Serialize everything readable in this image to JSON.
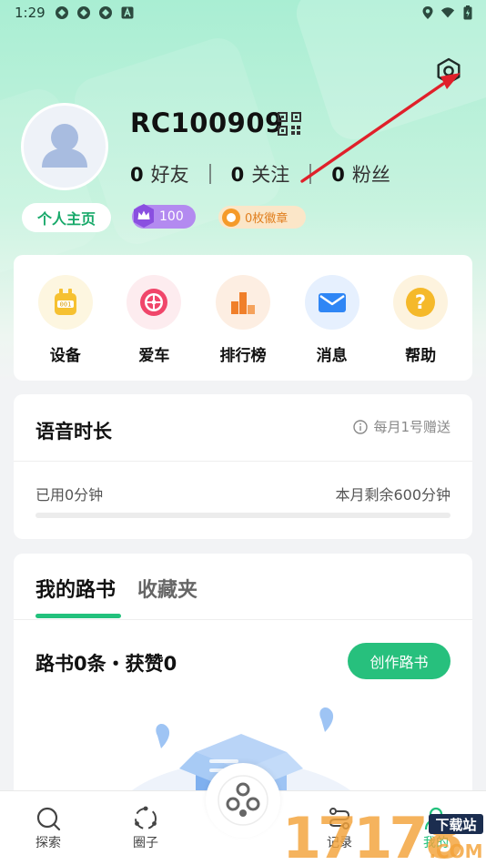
{
  "status_bar": {
    "time": "1:29",
    "left_icons": [
      "app-notification-icon",
      "app-notification-icon",
      "app-notification-icon",
      "a-box-icon"
    ],
    "right_icons": [
      "location-icon",
      "wifi-icon",
      "battery-icon"
    ]
  },
  "profile": {
    "username": "RC100909",
    "friends_count": "0",
    "friends_label": "好友",
    "following_count": "0",
    "following_label": "关注",
    "fans_count": "0",
    "fans_label": "粉丝",
    "homepage_label": "个人主页",
    "level": "100",
    "badges_label": "0枚徽章"
  },
  "quick_actions": [
    {
      "label": "设备",
      "icon": "device-icon",
      "color": "#f6c131"
    },
    {
      "label": "爱车",
      "icon": "wheel-icon",
      "color": "#f0466a"
    },
    {
      "label": "排行榜",
      "icon": "ranking-icon",
      "color": "#f07f2a"
    },
    {
      "label": "消息",
      "icon": "message-icon",
      "color": "#2f86f5"
    },
    {
      "label": "帮助",
      "icon": "help-icon",
      "color": "#f5b92a"
    }
  ],
  "voice": {
    "title": "语音时长",
    "note": "每月1号赠送",
    "used": "已用0分钟",
    "remaining": "本月剩余600分钟",
    "used_fraction": 0
  },
  "roadbook": {
    "tabs": [
      "我的路书",
      "收藏夹"
    ],
    "active_tab": 0,
    "count_text": "路书0条・获赞0",
    "create_label": "创作路书"
  },
  "bottom_nav": {
    "items": [
      {
        "label": "探索",
        "icon": "search-icon"
      },
      {
        "label": "圈子",
        "icon": "circle-icon"
      },
      {
        "label": "记录",
        "icon": "record-icon"
      },
      {
        "label": "我的",
        "icon": "profile-icon"
      }
    ],
    "center_icon": "hub-icon"
  },
  "watermark": {
    "text": "17178.COM",
    "tag": "下载站"
  },
  "colors": {
    "accent": "#22c17c",
    "header_bg": "#a9eed3",
    "annotation_arrow": "#e0202a"
  }
}
